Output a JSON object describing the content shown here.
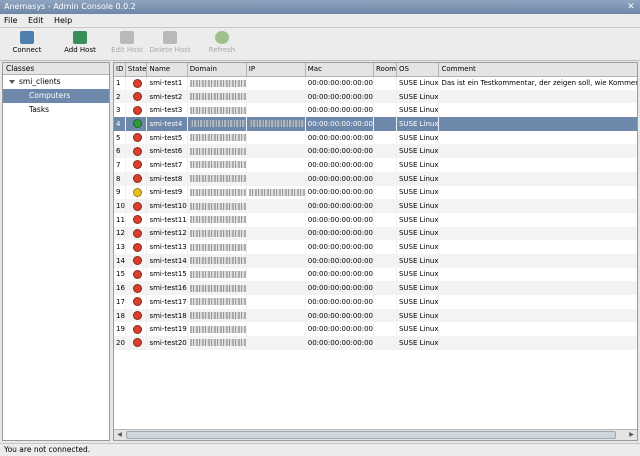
{
  "window": {
    "title": "Anemasys - Admin Console 0.0.2"
  },
  "menu": [
    "File",
    "Edit",
    "Help"
  ],
  "toolbar": [
    {
      "name": "connect-button",
      "label": "Connect",
      "icon": "connect-icon",
      "enabled": true,
      "color": "#4f7fae"
    },
    {
      "name": "add-host-button",
      "label": "Add Host",
      "icon": "add-host-icon",
      "enabled": true,
      "color": "#3a8f58"
    },
    {
      "name": "edit-host-button",
      "label": "Edit Host",
      "icon": "edit-host-icon",
      "enabled": false,
      "color": "#b9b9b9"
    },
    {
      "name": "delete-host-button",
      "label": "Delete Host",
      "icon": "delete-host-icon",
      "enabled": false,
      "color": "#b9b9b9"
    },
    {
      "name": "refresh-button",
      "label": "Refresh",
      "icon": "refresh-icon",
      "enabled": false,
      "color": "#9fc08a"
    }
  ],
  "sidebar": {
    "header": "Classes",
    "root": "smi_clients",
    "items": [
      {
        "label": "Computers",
        "selected": true
      },
      {
        "label": "Tasks",
        "selected": false
      }
    ]
  },
  "table": {
    "columns": [
      "ID",
      "State",
      "Name",
      "Domain",
      "IP",
      "Mac",
      "Room",
      "OS",
      "Comment"
    ],
    "selected_id": "4",
    "rows": [
      {
        "id": "1",
        "state": "red",
        "name": "smi-test1",
        "mac": "00:00:00:00:00:00",
        "os": "SUSE Linux",
        "comment": "Das ist ein Testkommentar, der zeigen soll, wie Kommentare"
      },
      {
        "id": "2",
        "state": "red",
        "name": "smi-test2",
        "mac": "00:00:00:00:00:00",
        "os": "SUSE Linux",
        "comment": ""
      },
      {
        "id": "3",
        "state": "red",
        "name": "smi-test3",
        "mac": "00:00:00:00:00:00",
        "os": "SUSE Linux",
        "comment": ""
      },
      {
        "id": "4",
        "state": "green",
        "name": "smi-test4",
        "mac": "00:00:00:00:00:00",
        "os": "SUSE Linux",
        "comment": ""
      },
      {
        "id": "5",
        "state": "red",
        "name": "smi-test5",
        "mac": "00:00:00:00:00:00",
        "os": "SUSE Linux",
        "comment": ""
      },
      {
        "id": "6",
        "state": "red",
        "name": "smi-test6",
        "mac": "00:00:00:00:00:00",
        "os": "SUSE Linux",
        "comment": ""
      },
      {
        "id": "7",
        "state": "red",
        "name": "smi-test7",
        "mac": "00:00:00:00:00:00",
        "os": "SUSE Linux",
        "comment": ""
      },
      {
        "id": "8",
        "state": "red",
        "name": "smi-test8",
        "mac": "00:00:00:00:00:00",
        "os": "SUSE Linux",
        "comment": ""
      },
      {
        "id": "9",
        "state": "yellow",
        "name": "smi-test9",
        "mac": "00:00:00:00:00:00",
        "os": "SUSE Linux",
        "comment": ""
      },
      {
        "id": "10",
        "state": "red",
        "name": "smi-test10",
        "mac": "00:00:00:00:00:00",
        "os": "SUSE Linux",
        "comment": ""
      },
      {
        "id": "11",
        "state": "red",
        "name": "smi-test11",
        "mac": "00:00:00:00:00:00",
        "os": "SUSE Linux",
        "comment": ""
      },
      {
        "id": "12",
        "state": "red",
        "name": "smi-test12",
        "mac": "00:00:00:00:00:00",
        "os": "SUSE Linux",
        "comment": ""
      },
      {
        "id": "13",
        "state": "red",
        "name": "smi-test13",
        "mac": "00:00:00:00:00:00",
        "os": "SUSE Linux",
        "comment": ""
      },
      {
        "id": "14",
        "state": "red",
        "name": "smi-test14",
        "mac": "00:00:00:00:00:00",
        "os": "SUSE Linux",
        "comment": ""
      },
      {
        "id": "15",
        "state": "red",
        "name": "smi-test15",
        "mac": "00:00:00:00:00:00",
        "os": "SUSE Linux",
        "comment": ""
      },
      {
        "id": "16",
        "state": "red",
        "name": "smi-test16",
        "mac": "00:00:00:00:00:00",
        "os": "SUSE Linux",
        "comment": ""
      },
      {
        "id": "17",
        "state": "red",
        "name": "smi-test17",
        "mac": "00:00:00:00:00:00",
        "os": "SUSE Linux",
        "comment": ""
      },
      {
        "id": "18",
        "state": "red",
        "name": "smi-test18",
        "mac": "00:00:00:00:00:00",
        "os": "SUSE Linux",
        "comment": ""
      },
      {
        "id": "19",
        "state": "red",
        "name": "smi-test19",
        "mac": "00:00:00:00:00:00",
        "os": "SUSE Linux",
        "comment": ""
      },
      {
        "id": "20",
        "state": "red",
        "name": "smi-test20",
        "mac": "00:00:00:00:00:00",
        "os": "SUSE Linux",
        "comment": ""
      }
    ]
  },
  "state_colors": {
    "red": "#d8402a",
    "green": "#2f9a3a",
    "yellow": "#e8c020"
  },
  "status": {
    "text": "You are not connected."
  }
}
